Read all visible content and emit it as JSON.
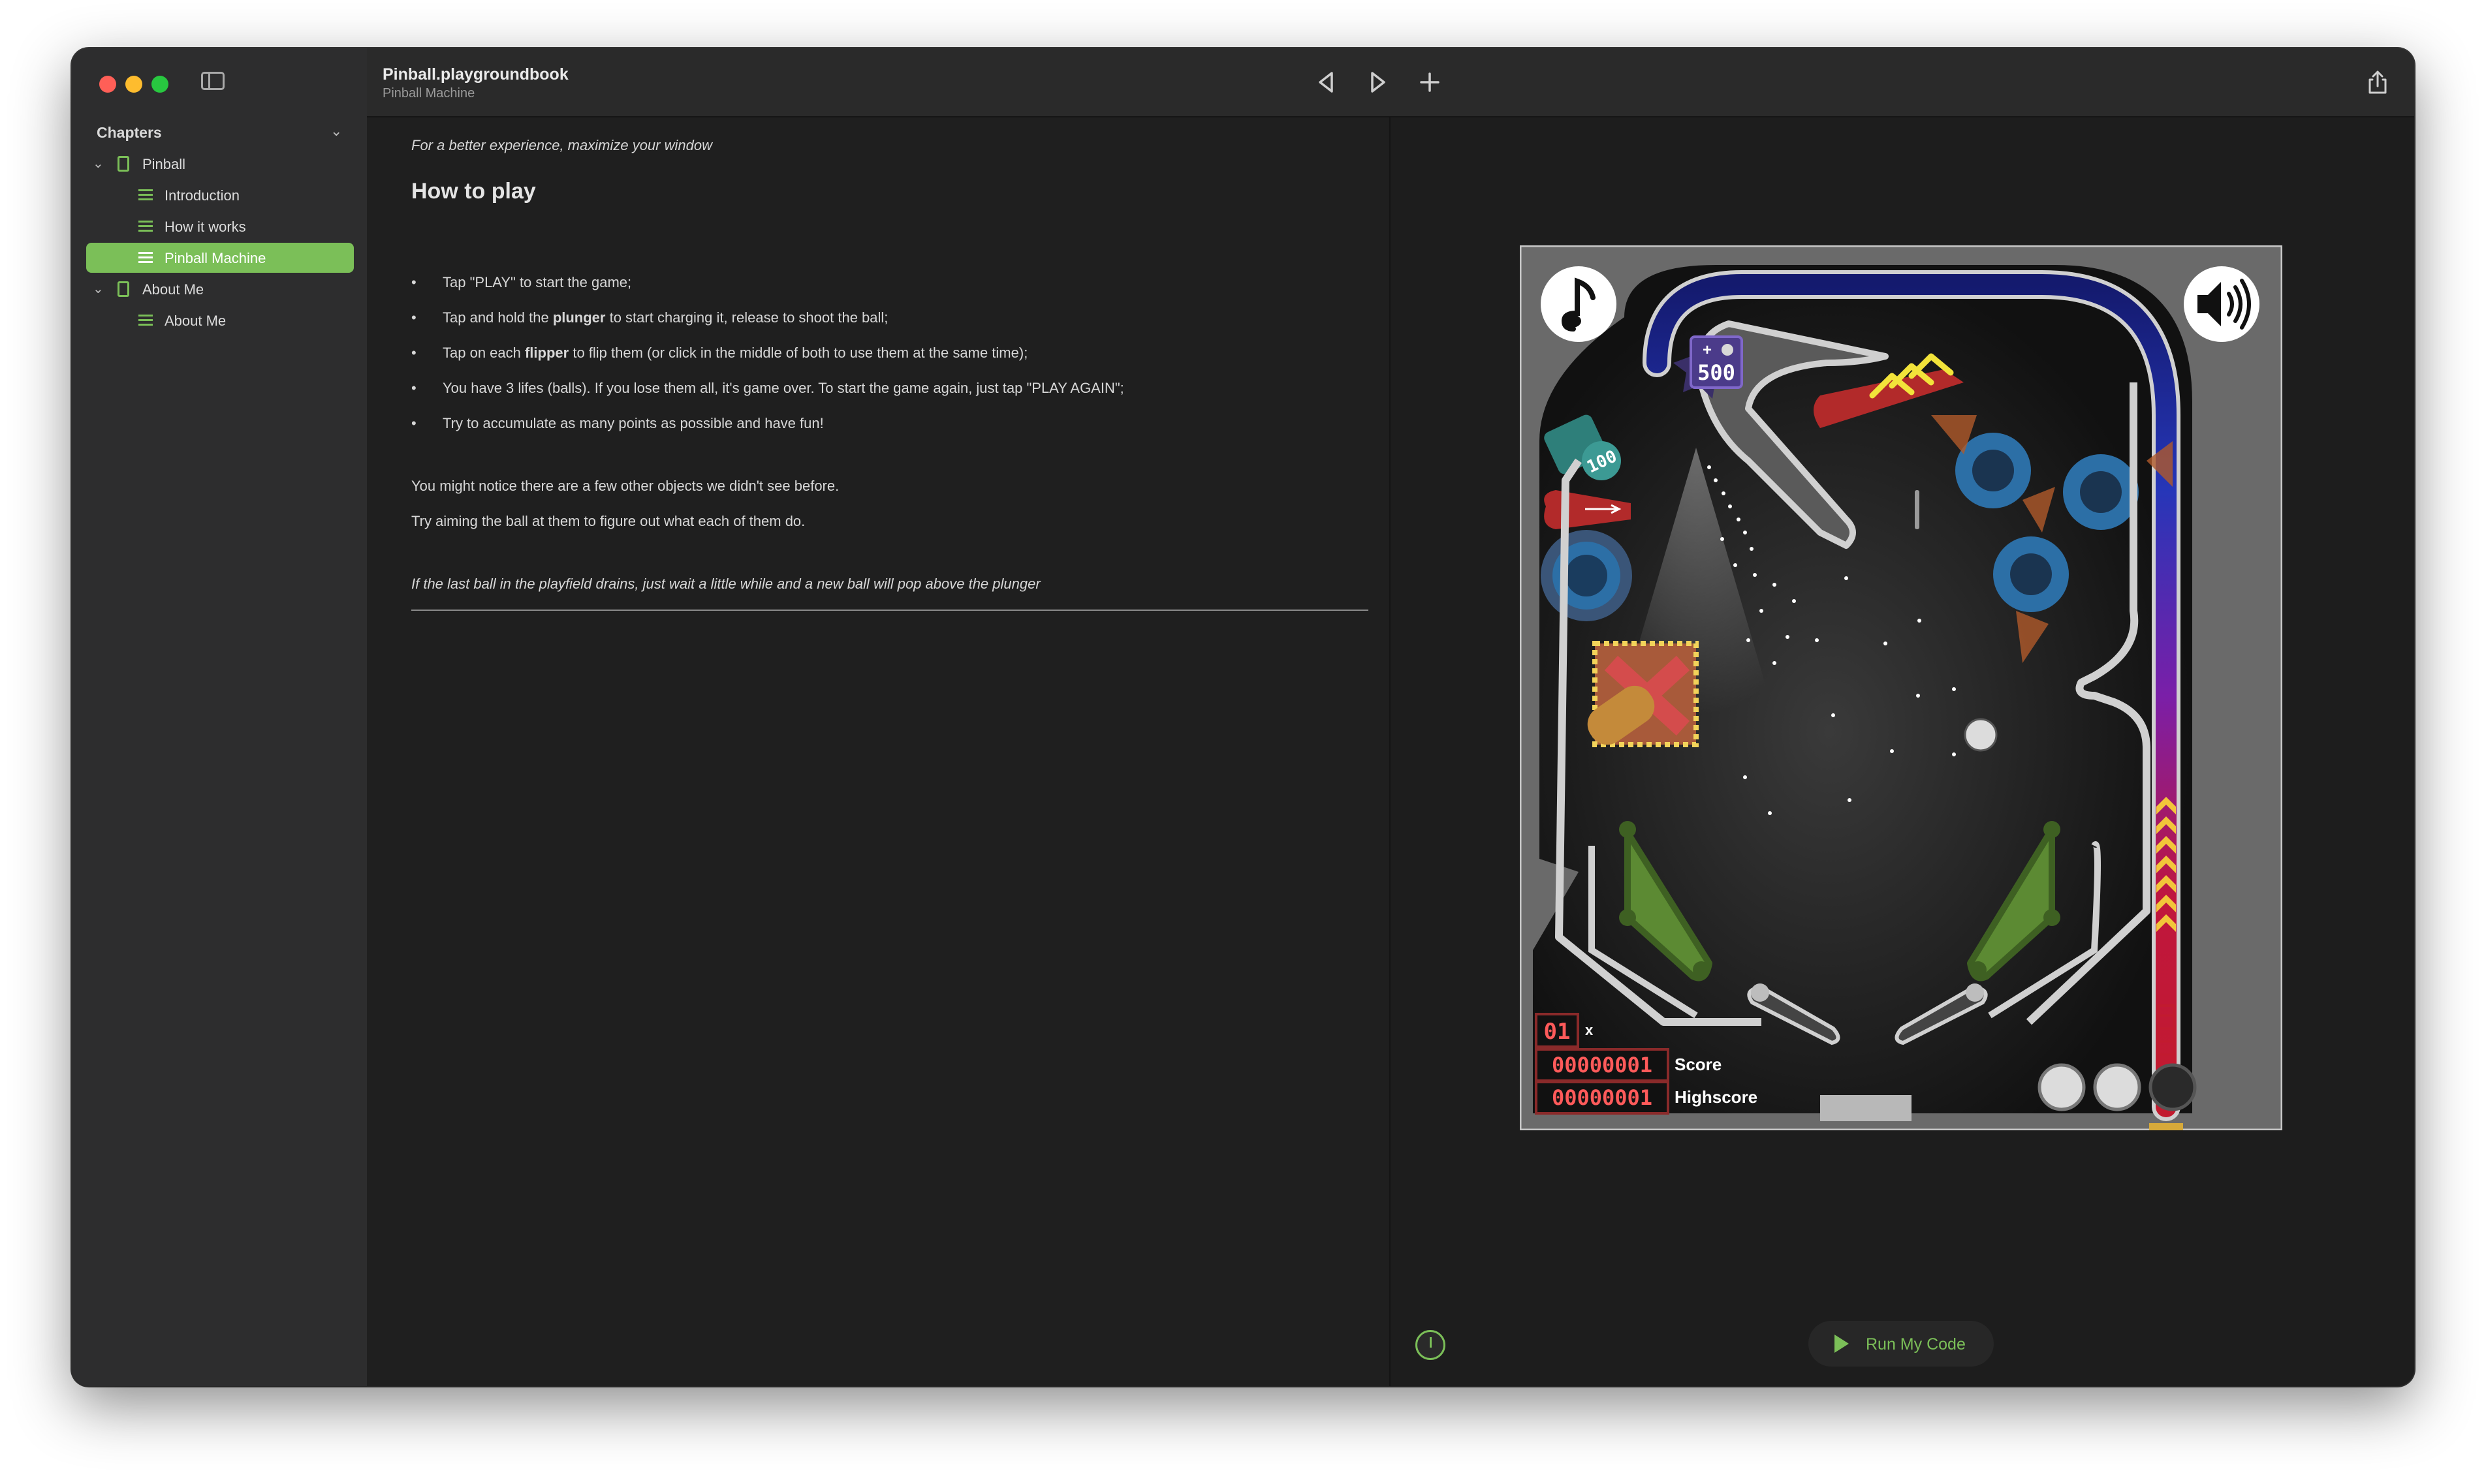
{
  "window": {
    "document_title": "Pinball.playgroundbook",
    "document_subtitle": "Pinball Machine"
  },
  "sidebar": {
    "heading": "Chapters",
    "items": [
      {
        "label": "Pinball",
        "kind": "chapter",
        "expanded": true
      },
      {
        "label": "Introduction",
        "kind": "page"
      },
      {
        "label": "How it works",
        "kind": "page"
      },
      {
        "label": "Pinball Machine",
        "kind": "page",
        "selected": true
      },
      {
        "label": "About Me",
        "kind": "chapter",
        "expanded": true
      },
      {
        "label": "About Me",
        "kind": "page"
      }
    ]
  },
  "toolbar": {
    "back_icon": "triangle-left-icon",
    "forward_icon": "triangle-right-icon",
    "add_icon": "plus-icon",
    "share_icon": "share-icon"
  },
  "content": {
    "note": "For a better experience, maximize your window",
    "heading": "How to play",
    "bullets": [
      {
        "parts": [
          "Tap \"PLAY\" to start the game;"
        ]
      },
      {
        "parts": [
          "Tap and hold the ",
          "plunger",
          " to start charging it, release to shoot the ball;"
        ]
      },
      {
        "parts": [
          "Tap on each ",
          "flipper",
          " to flip them (or click in the middle of both to use them at the same time);"
        ]
      },
      {
        "parts": [
          "You have 3 lifes (balls). If you lose them all, it's game over. To start the game again, just tap \"PLAY AGAIN\";"
        ]
      },
      {
        "parts": [
          "Try to accumulate as many points as possible and have fun!"
        ]
      }
    ],
    "paragraph1": "You might notice there are a few other objects we didn't see before.",
    "paragraph2": "Try aiming the ball at them to figure out what each of them do.",
    "footer_note": "If the last ball in the playfield drains, just wait a little while and a new ball will pop above the plunger"
  },
  "game": {
    "bonus_500": "500",
    "bonus_plus": "+",
    "bonus_100": "100",
    "multiplier": "01",
    "multiplier_suffix": "x",
    "score": "00000001",
    "score_label": "Score",
    "highscore": "00000001",
    "highscore_label": "Highscore",
    "balls_remaining": 2,
    "balls_total": 3,
    "colors": {
      "accent": "#7bbf58",
      "bumper": "#2c6fa6",
      "flipper_bed": "#5c8a33",
      "rail_top": "#1b2a9a",
      "rail_bottom": "#c21b2f"
    }
  },
  "run_button": {
    "label": "Run My Code"
  }
}
